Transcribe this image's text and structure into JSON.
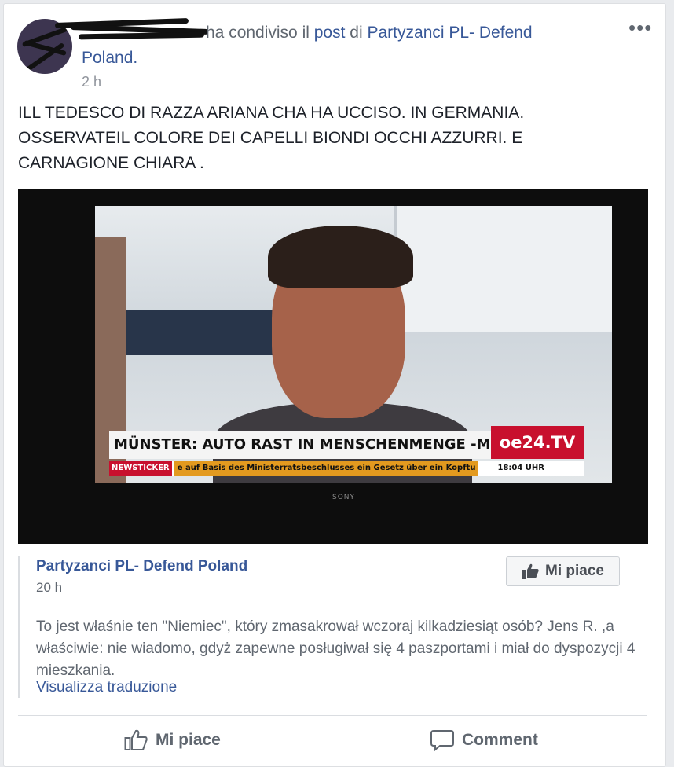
{
  "header": {
    "shared_text": "ha condiviso il",
    "post_link": "post",
    "of_text": "di",
    "page_link": "Partyzanci PL- Defend",
    "page_link_cont": "Poland.",
    "timestamp": "2 h",
    "more_label": "•••"
  },
  "post": {
    "message": "ILL TEDESCO DI RAZZA ARIANA CHA HA UCCISO. IN GERMANIA.\nOSSERVATEIL COLORE DEI CAPELLI BIONDI OCCHI AZZURRI. E\nCARNAGIONE CHIARA ."
  },
  "photo": {
    "headline": "MÜNSTER: AUTO RAST IN MENSCHENMENGE -MEHRERE TOTE",
    "channel": "oe24.TV",
    "ticker_tag": "NEWSTICKER",
    "ticker_text": "e auf Basis des Ministerratsbeschlusses ein Gesetz über ein Kopftu",
    "ticker_time": "18:04 UHR",
    "tv_brand": "SONY"
  },
  "shared_post": {
    "page_name": "Partyzanci PL- Defend Poland",
    "timestamp": "20 h",
    "like_label": "Mi piace",
    "text": "To jest właśnie ten \"Niemiec\", który zmasakrował wczoraj kilkadziesiąt osób? Jens R. ,a właściwie: nie wiadomo, gdyż zapewne posługiwał się 4 paszportami i miał do dyspozycji 4 mieszkania.",
    "translate_link": "Visualizza traduzione"
  },
  "actions": {
    "like": "Mi piace",
    "comment": "Comment"
  },
  "colors": {
    "link": "#385898",
    "text": "#1d2129",
    "muted": "#606770",
    "channel_red": "#c8102e"
  }
}
